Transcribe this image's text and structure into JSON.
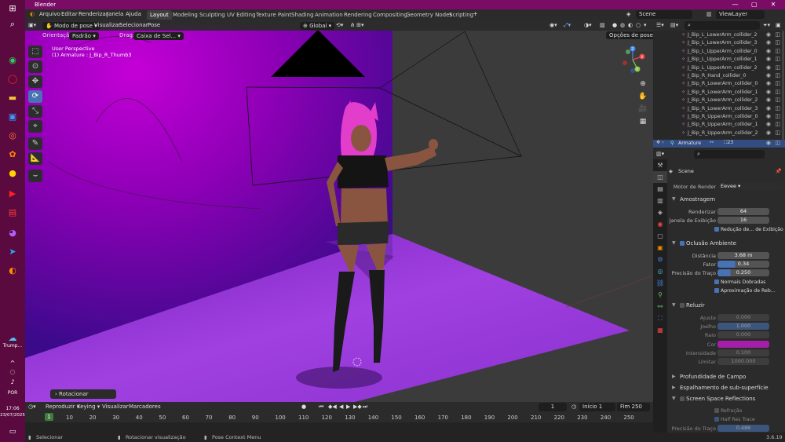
{
  "app": {
    "title": "Blender",
    "version": "3.6.19"
  },
  "taskbar": {
    "icons": [
      "windows-icon",
      "search-icon",
      "whatsapp-icon",
      "opera-icon",
      "folder-icon",
      "store-icon",
      "podcast-icon",
      "fl-studio-icon",
      "chrome-icon",
      "youtube-icon",
      "news-icon",
      "messenger-icon",
      "telegram-icon",
      "blender-icon"
    ],
    "trump_label": "Trump...",
    "lang": "POR",
    "time": "17:06",
    "date": "23/07/2025"
  },
  "menu": {
    "items": [
      "Arquivo",
      "Editar",
      "Renderizar",
      "Janela",
      "Ajuda"
    ],
    "workspaces": [
      "Layout",
      "Modeling",
      "Sculpting",
      "UV Editing",
      "Texture Paint",
      "Shading",
      "Animation",
      "Rendering",
      "Compositing",
      "Geometry Nodes",
      "Scripting"
    ],
    "active_workspace": "Layout",
    "scene": "Scene",
    "view_layer": "ViewLayer"
  },
  "viewport": {
    "mode": "Modo de pose",
    "menus": [
      "Visualizar",
      "Selecionar",
      "Pose"
    ],
    "transform_orientation": "Global",
    "options": "Opções de pose",
    "orientation_label": "Orientação:",
    "orientation_value": "Padrão",
    "drag_label": "Drag:",
    "drag_value": "Caixa de Sel...",
    "overlay_line1": "User Perspective",
    "overlay_line2": "(1) Armature : J_Bip_R_Thumb3",
    "last_operator": "Rotacionar",
    "gizmo_axes": [
      "X",
      "Y",
      "Z"
    ],
    "colors": {
      "wall": "#8a00b0",
      "floor": "#9a30d8",
      "bg": "#3b3b3b"
    }
  },
  "timeline": {
    "menus": [
      "Reproduzir",
      "Keying",
      "Visualizar",
      "Marcadores"
    ],
    "current_frame": "1",
    "start_label": "Início",
    "start": "1",
    "end_label": "Fim",
    "end": "250",
    "frame_marker": "1",
    "ticks": [
      "10",
      "20",
      "30",
      "40",
      "50",
      "60",
      "70",
      "80",
      "90",
      "100",
      "110",
      "120",
      "130",
      "140",
      "150",
      "160",
      "170",
      "180",
      "190",
      "200",
      "210",
      "220",
      "230",
      "240",
      "250"
    ]
  },
  "status": {
    "select": "Selecionar",
    "rotate_view": "Rotacionar visualização",
    "context_menu": "Pose Context Menu"
  },
  "outliner": {
    "rows": [
      "J_Bip_L_LowerArm_collider_2",
      "J_Bip_L_LowerArm_collider_3",
      "J_Bip_L_UpperArm_collider_0",
      "J_Bip_L_UpperArm_collider_1",
      "J_Bip_L_UpperArm_collider_2",
      "J_Bip_R_Hand_collider_0",
      "J_Bip_R_LowerArm_collider_0",
      "J_Bip_R_LowerArm_collider_1",
      "J_Bip_R_LowerArm_collider_2",
      "J_Bip_R_LowerArm_collider_3",
      "J_Bip_R_UpperArm_collider_0",
      "J_Bip_R_UpperArm_collider_1",
      "J_Bip_R_UpperArm_collider_2"
    ],
    "selected": "Armature",
    "selected_count": "23"
  },
  "properties": {
    "scene": "Scene",
    "render_engine_label": "Motor de Render",
    "render_engine": "Eevee",
    "sampling": {
      "title": "Amostragem",
      "render_label": "Renderizar",
      "render": "64",
      "viewport_label": "Janela de Exibição",
      "viewport": "16",
      "denoise": "Redução de... de Exibição"
    },
    "ao": {
      "title": "Oclusão Ambiente",
      "distance_label": "Distância",
      "distance": "3.68 m",
      "factor_label": "Fator",
      "factor": "0.34",
      "factor_fraction": 0.34,
      "trace_label": "Precisão do Traço",
      "trace": "0.250",
      "trace_fraction": 0.25,
      "bent_normals": "Normais Dobradas",
      "bounce": "Aproximação de Reb..."
    },
    "bloom": {
      "title": "Reluzir",
      "threshold_label": "Ajuste",
      "threshold": "0.000",
      "knee_label": "Joelho",
      "knee": "1.000",
      "radius_label": "Raio",
      "radius": "0.000",
      "color_label": "Cor",
      "color": "#a41ea8",
      "intensity_label": "Intensidade",
      "intensity": "0.100",
      "clamp_label": "Limitar",
      "clamp": "1000.000"
    },
    "dof": {
      "title": "Profundidade de Campo"
    },
    "sss": {
      "title": "Espalhamento de sub-superfície"
    },
    "ssr": {
      "title": "Screen Space Reflections",
      "refraction": "Refração",
      "half_res": "Half Res Trace",
      "trace_label": "Precisão do Traço",
      "trace": "0.486"
    }
  }
}
